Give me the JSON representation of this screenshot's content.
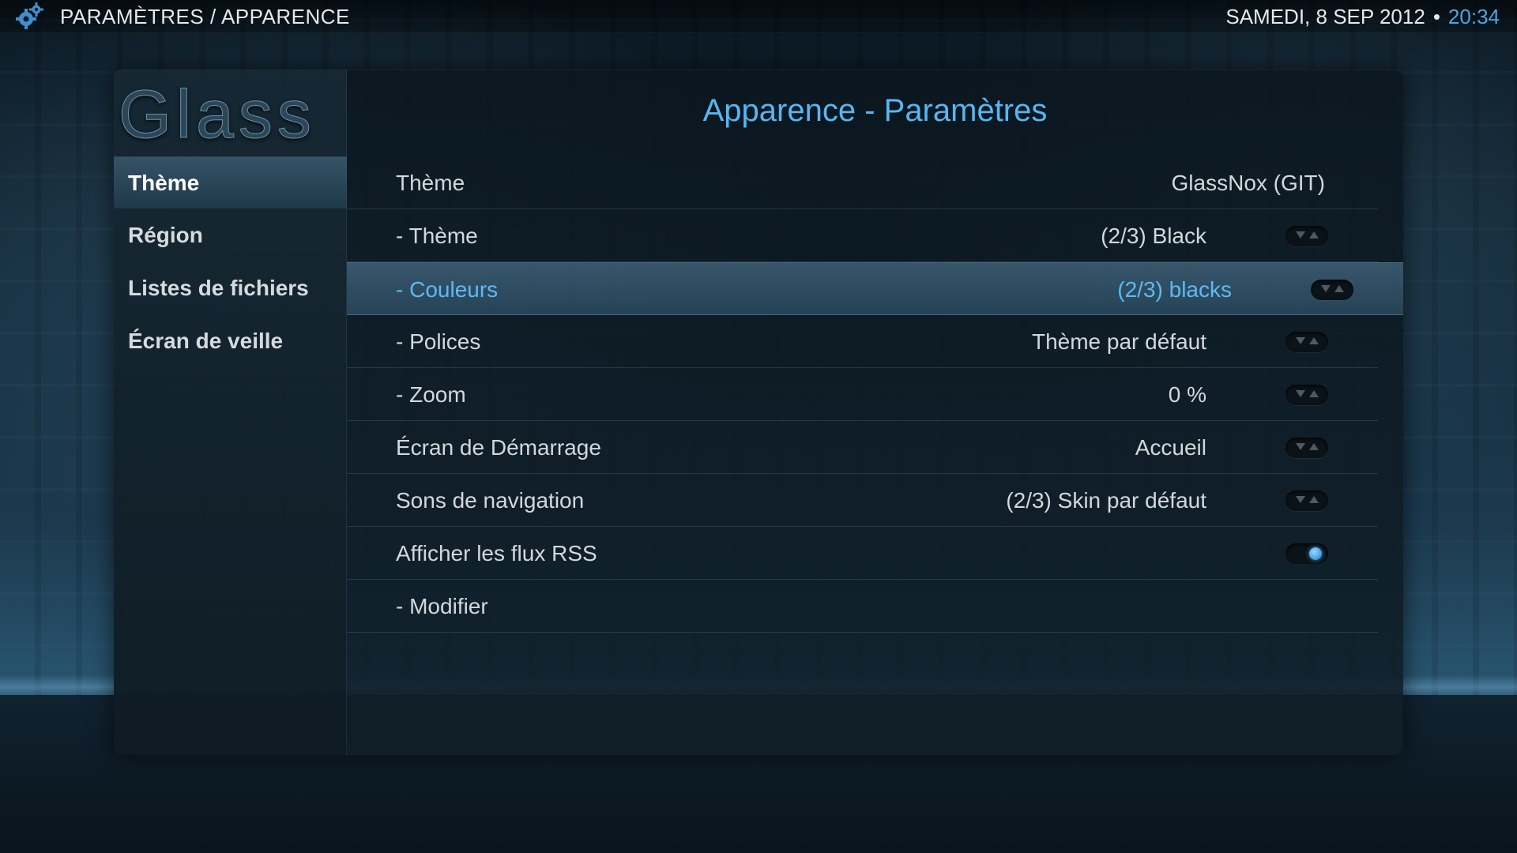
{
  "header": {
    "breadcrumb": "PARAMÈTRES / APPARENCE",
    "date": "SAMEDI, 8 SEP 2012",
    "separator": "•",
    "time": "20:34",
    "icon": "gear-icon"
  },
  "sidebar": {
    "logo": "Glass",
    "items": [
      {
        "label": "Thème",
        "active": true
      },
      {
        "label": "Région"
      },
      {
        "label": "Listes de fichiers"
      },
      {
        "label": "Écran de veille"
      }
    ]
  },
  "main": {
    "title": "Apparence - Paramètres",
    "rows": [
      {
        "label": "Thème",
        "value": "GlassNox (GIT)",
        "control": "none"
      },
      {
        "label": "- Thème",
        "value": "(2/3) Black",
        "control": "spinner"
      },
      {
        "label": "- Couleurs",
        "value": "(2/3) blacks",
        "control": "spinner",
        "selected": true
      },
      {
        "label": "- Polices",
        "value": "Thème par défaut",
        "control": "spinner"
      },
      {
        "label": "- Zoom",
        "value": "0 %",
        "control": "spinner"
      },
      {
        "label": "Écran de Démarrage",
        "value": "Accueil",
        "control": "spinner"
      },
      {
        "label": "Sons de navigation",
        "value": "(2/3) Skin par défaut",
        "control": "spinner"
      },
      {
        "label": "Afficher les flux RSS",
        "value": "",
        "control": "toggle",
        "state": "on"
      },
      {
        "label": "- Modifier",
        "value": "",
        "control": "none"
      }
    ]
  },
  "colors": {
    "accent": "#58b6f2",
    "time": "#4aa6e6",
    "text": "#d2d8dc"
  }
}
